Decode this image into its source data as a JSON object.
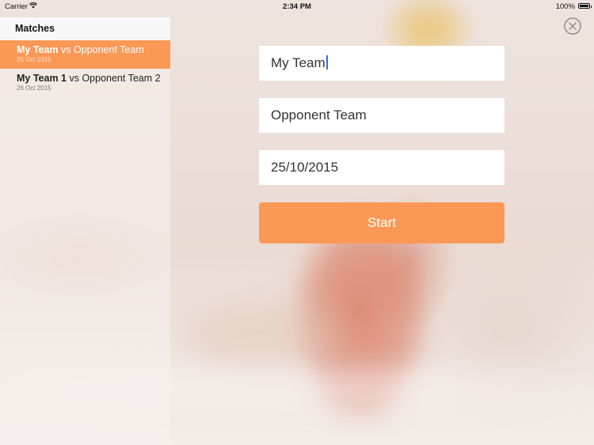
{
  "status_bar": {
    "carrier": "Carrier",
    "time": "2:34 PM",
    "battery": "100%"
  },
  "sidebar": {
    "title": "Matches",
    "items": [
      {
        "team_a": "My Team",
        "vs": " vs ",
        "team_b": "Opponent Team",
        "date": "25 Oct 2015",
        "selected": true
      },
      {
        "team_a": "My Team 1",
        "vs": " vs ",
        "team_b": "Opponent Team 2",
        "date": "26 Oct 2015",
        "selected": false
      }
    ]
  },
  "form": {
    "team_field": "My Team",
    "opponent_field": "Opponent Team",
    "date_field": "25/10/2015",
    "start_label": "Start"
  },
  "colors": {
    "accent": "#fc9856",
    "caret": "#2d6fd8"
  },
  "icons": {
    "close": "close-icon",
    "wifi": "wifi-icon",
    "battery": "battery-icon"
  }
}
